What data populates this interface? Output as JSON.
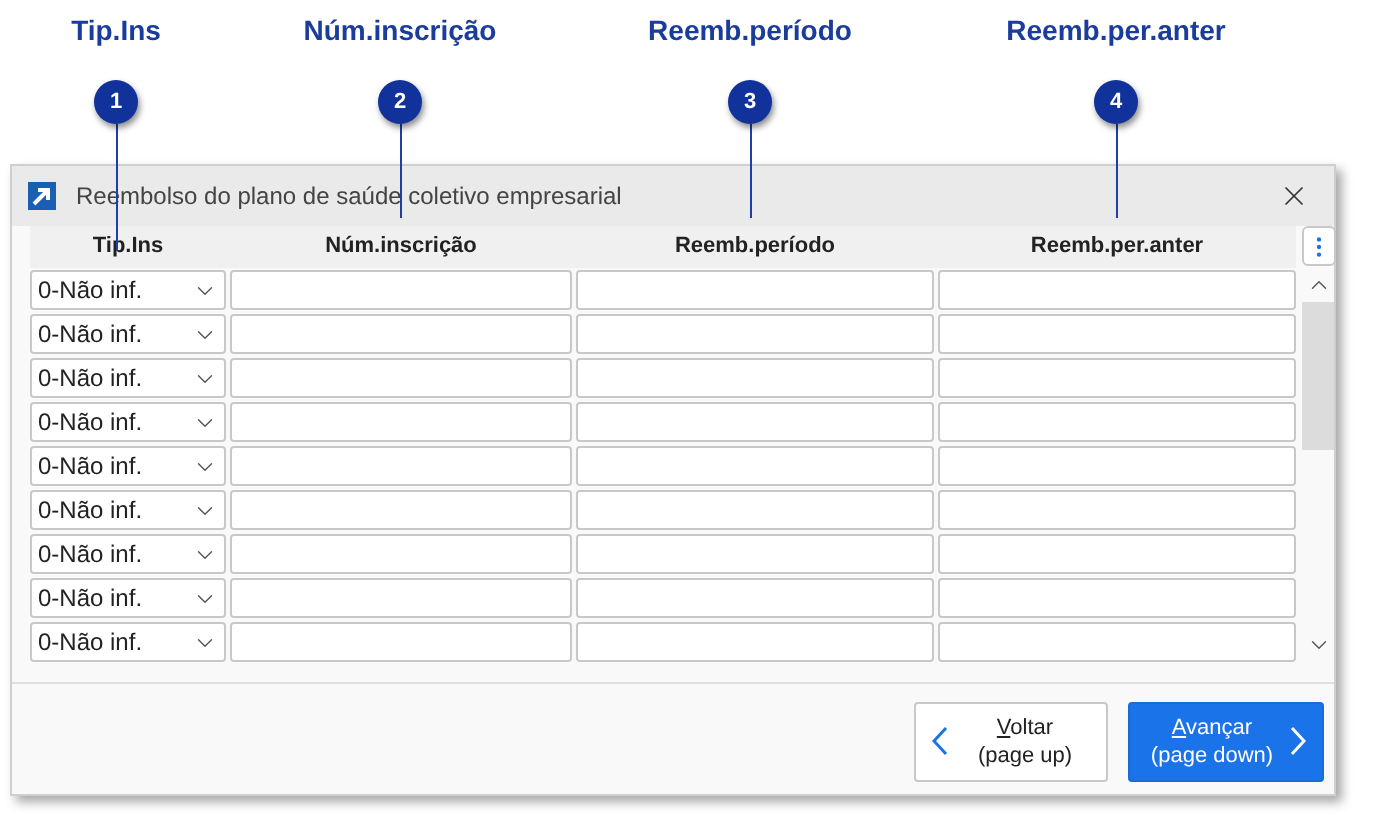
{
  "callouts": [
    {
      "number": "1",
      "label": "Tip.Ins"
    },
    {
      "number": "2",
      "label": "Núm.inscrição"
    },
    {
      "number": "3",
      "label": "Reemb.período"
    },
    {
      "number": "4",
      "label": "Reemb.per.anter"
    }
  ],
  "window": {
    "title": "Reembolso do plano de saúde coletivo empresarial",
    "columns": [
      "Tip.Ins",
      "Núm.inscrição",
      "Reemb.período",
      "Reemb.per.anter"
    ],
    "rows": [
      {
        "tip_ins": "0-Não inf."
      },
      {
        "tip_ins": "0-Não inf."
      },
      {
        "tip_ins": "0-Não inf."
      },
      {
        "tip_ins": "0-Não inf."
      },
      {
        "tip_ins": "0-Não inf."
      },
      {
        "tip_ins": "0-Não inf."
      },
      {
        "tip_ins": "0-Não inf."
      },
      {
        "tip_ins": "0-Não inf."
      },
      {
        "tip_ins": "0-Não inf."
      }
    ],
    "buttons": [
      {
        "kind": "back",
        "mnemonic": "V",
        "label_rest": "oltar",
        "hint": "(page up)"
      },
      {
        "kind": "next",
        "mnemonic": "A",
        "label_rest": "vançar",
        "hint": "(page down)"
      }
    ]
  }
}
